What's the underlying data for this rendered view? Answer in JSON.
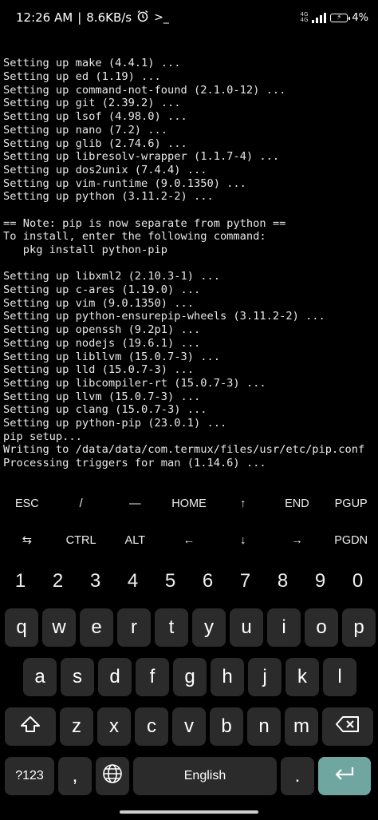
{
  "status": {
    "time": "12:26 AM",
    "speed": "8.6KB/s",
    "net_top": "4G",
    "net_bottom": "4G",
    "battery": "4%"
  },
  "terminal_lines": [
    "Setting up make (4.4.1) ...",
    "Setting up ed (1.19) ...",
    "Setting up command-not-found (2.1.0-12) ...",
    "Setting up git (2.39.2) ...",
    "Setting up lsof (4.98.0) ...",
    "Setting up nano (7.2) ...",
    "Setting up glib (2.74.6) ...",
    "Setting up libresolv-wrapper (1.1.7-4) ...",
    "Setting up dos2unix (7.4.4) ...",
    "Setting up vim-runtime (9.0.1350) ...",
    "Setting up python (3.11.2-2) ...",
    "",
    "== Note: pip is now separate from python ==",
    "To install, enter the following command:",
    "   pkg install python-pip",
    "",
    "Setting up libxml2 (2.10.3-1) ...",
    "Setting up c-ares (1.19.0) ...",
    "Setting up vim (9.0.1350) ...",
    "Setting up python-ensurepip-wheels (3.11.2-2) ...",
    "Setting up openssh (9.2p1) ...",
    "Setting up nodejs (19.6.1) ...",
    "Setting up libllvm (15.0.7-3) ...",
    "Setting up lld (15.0.7-3) ...",
    "Setting up libcompiler-rt (15.0.7-3) ...",
    "Setting up llvm (15.0.7-3) ...",
    "Setting up clang (15.0.7-3) ...",
    "Setting up python-pip (23.0.1) ...",
    "pip setup...",
    "Writing to /data/data/com.termux/files/usr/etc/pip.conf",
    "Processing triggers for man (1.14.6) ..."
  ],
  "prompt": {
    "tilde": "~",
    "dollar": "$"
  },
  "extra_keys": {
    "row1": [
      "ESC",
      "/",
      "—",
      "HOME",
      "↑",
      "END",
      "PGUP"
    ],
    "row2": [
      "⇆",
      "CTRL",
      "ALT",
      "←",
      "↓",
      "→",
      "PGDN"
    ]
  },
  "keyboard": {
    "numbers": [
      "1",
      "2",
      "3",
      "4",
      "5",
      "6",
      "7",
      "8",
      "9",
      "0"
    ],
    "row1": [
      "q",
      "w",
      "e",
      "r",
      "t",
      "y",
      "u",
      "i",
      "o",
      "p"
    ],
    "row2": [
      "a",
      "s",
      "d",
      "f",
      "g",
      "h",
      "j",
      "k",
      "l"
    ],
    "row3": [
      "z",
      "x",
      "c",
      "v",
      "b",
      "n",
      "m"
    ],
    "symbols_label": "?123",
    "comma": ",",
    "space_label": "English",
    "period": ".",
    "enter_icon": "enter-icon",
    "shift_icon": "shift-icon",
    "backspace_icon": "backspace-icon",
    "globe_icon": "globe-icon",
    "enter_color": "#6fa7a0"
  }
}
